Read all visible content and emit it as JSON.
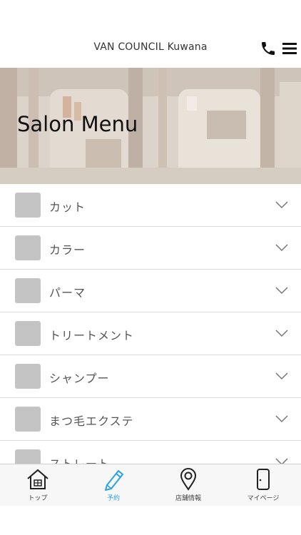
{
  "header": {
    "title": "VAN COUNCIL Kuwana"
  },
  "hero": {
    "title": "Salon Menu"
  },
  "menu": {
    "items": [
      {
        "label": "カット"
      },
      {
        "label": "カラー"
      },
      {
        "label": "パーマ"
      },
      {
        "label": "トリートメント"
      },
      {
        "label": "シャンプー"
      },
      {
        "label": "まつ毛エクステ"
      },
      {
        "label": "ストレート"
      }
    ]
  },
  "tabbar": {
    "tabs": [
      {
        "label": "トップ",
        "icon": "home-icon"
      },
      {
        "label": "予約",
        "icon": "pencil-icon",
        "active": true
      },
      {
        "label": "店舗情報",
        "icon": "map-pin-icon"
      },
      {
        "label": "マイページ",
        "icon": "phone-device-icon"
      }
    ]
  },
  "colors": {
    "accent": "#2aa2e4",
    "thumb": "#c4c4c4",
    "divider": "#dcdcdc",
    "tabbar_bg": "#f7f7f7"
  }
}
